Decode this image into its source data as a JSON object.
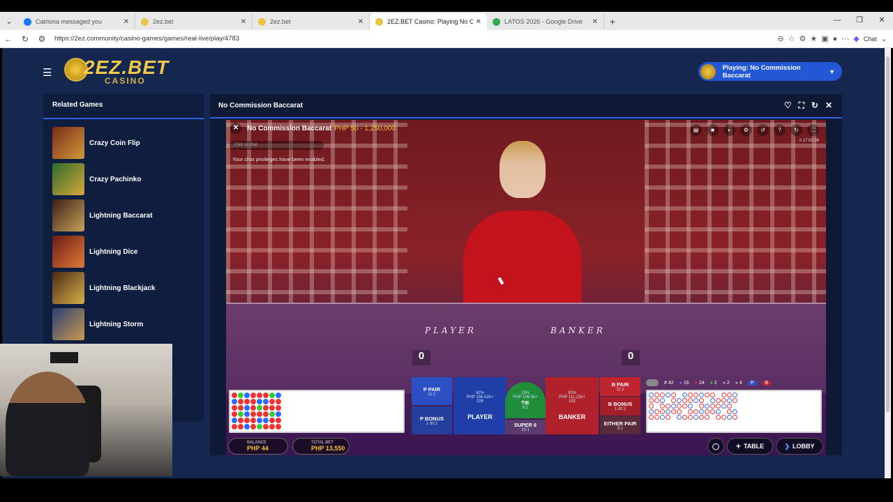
{
  "browser": {
    "tabs": [
      {
        "title": "Catriona messaged you",
        "fav": "#1877f2"
      },
      {
        "title": "2ez.bet",
        "fav": "#e8c547"
      },
      {
        "title": "2ez.bet",
        "fav": "#e8c547"
      },
      {
        "title": "2EZ.BET Casino: Playing No C",
        "fav": "#e8c547"
      },
      {
        "title": "LATOS 2026 - Google Drive",
        "fav": "#34a853"
      }
    ],
    "url": "https://2ez.community/casino-games/games/real-live/play/4783",
    "chat_label": "Chat"
  },
  "site": {
    "brand": "2EZ.BET",
    "brand_sub": "CASINO",
    "playing_label": "Playing: No Commission Baccarat"
  },
  "related": {
    "title": "Related Games",
    "games": [
      {
        "name": "Crazy Coin Flip",
        "color": "#7a2b16"
      },
      {
        "name": "Crazy Pachinko",
        "color": "#2e6b2a"
      },
      {
        "name": "Lightning Baccarat",
        "color": "#3a1f16"
      },
      {
        "name": "Lightning Dice",
        "color": "#6a1b14"
      },
      {
        "name": "Lightning Blackjack",
        "color": "#4a2a16"
      },
      {
        "name": "Lightning Storm",
        "color": "#2a3f76"
      }
    ]
  },
  "game": {
    "panel_title": "No Commission Baccarat",
    "video_title": "No Commission Baccarat",
    "limits": "PHP 50 - 1,250,000",
    "chat_placeholder": "Click to chat",
    "chat_message": "Your chat privileges have been enabled.",
    "clock": "# 17:05:36",
    "player_label": "PLAYER",
    "banker_label": "BANKER",
    "player_score": "0",
    "banker_score": "0",
    "bets": {
      "p_pair": "P PAIR",
      "p_pair_odds": "11:1",
      "p_bonus": "P BONUS",
      "p_bonus_odds": "1-30:1",
      "player": "PLAYER",
      "player_amt": "PHP 156.62k+",
      "player_count": "226",
      "player_pct": "42%",
      "tie": "TIE",
      "tie_odds": "8:1",
      "tie_amt": "PHP 106.5k+",
      "tie_pct": "28%",
      "super6": "SUPER 6",
      "super6_odds": "15:1",
      "banker": "BANKER",
      "banker_amt": "PHP 111.22k+",
      "banker_count": "192",
      "banker_pct": "30%",
      "b_pair": "B PAIR",
      "b_pair_odds": "11:1",
      "b_bonus": "B BONUS",
      "b_bonus_odds": "1-30:1",
      "either_pair": "EITHER PAIR",
      "either_pair_odds": "5:1"
    },
    "stats": {
      "total": "# 42",
      "player": "16",
      "banker": "24",
      "tie": "2",
      "ppair": "2",
      "bpair": "4",
      "bpair_label": "B"
    },
    "balance_label": "BALANCE",
    "balance": "PHP 44",
    "total_bet_label": "TOTAL BET",
    "total_bet": "PHP 13,550",
    "table_btn": "TABLE",
    "lobby_btn": "LOBBY"
  }
}
